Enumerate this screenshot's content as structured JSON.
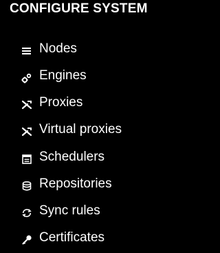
{
  "section": {
    "title": "CONFIGURE SYSTEM"
  },
  "nav": {
    "items": [
      {
        "label": "Nodes",
        "icon": "list-icon"
      },
      {
        "label": "Engines",
        "icon": "gears-icon"
      },
      {
        "label": "Proxies",
        "icon": "proxy-icon"
      },
      {
        "label": "Virtual proxies",
        "icon": "virtual-proxy-icon"
      },
      {
        "label": "Schedulers",
        "icon": "calendar-icon"
      },
      {
        "label": "Repositories",
        "icon": "database-icon"
      },
      {
        "label": "Sync rules",
        "icon": "sync-icon"
      },
      {
        "label": "Certificates",
        "icon": "key-icon"
      }
    ]
  },
  "colors": {
    "background": "#000000",
    "text": "#ffffff"
  }
}
